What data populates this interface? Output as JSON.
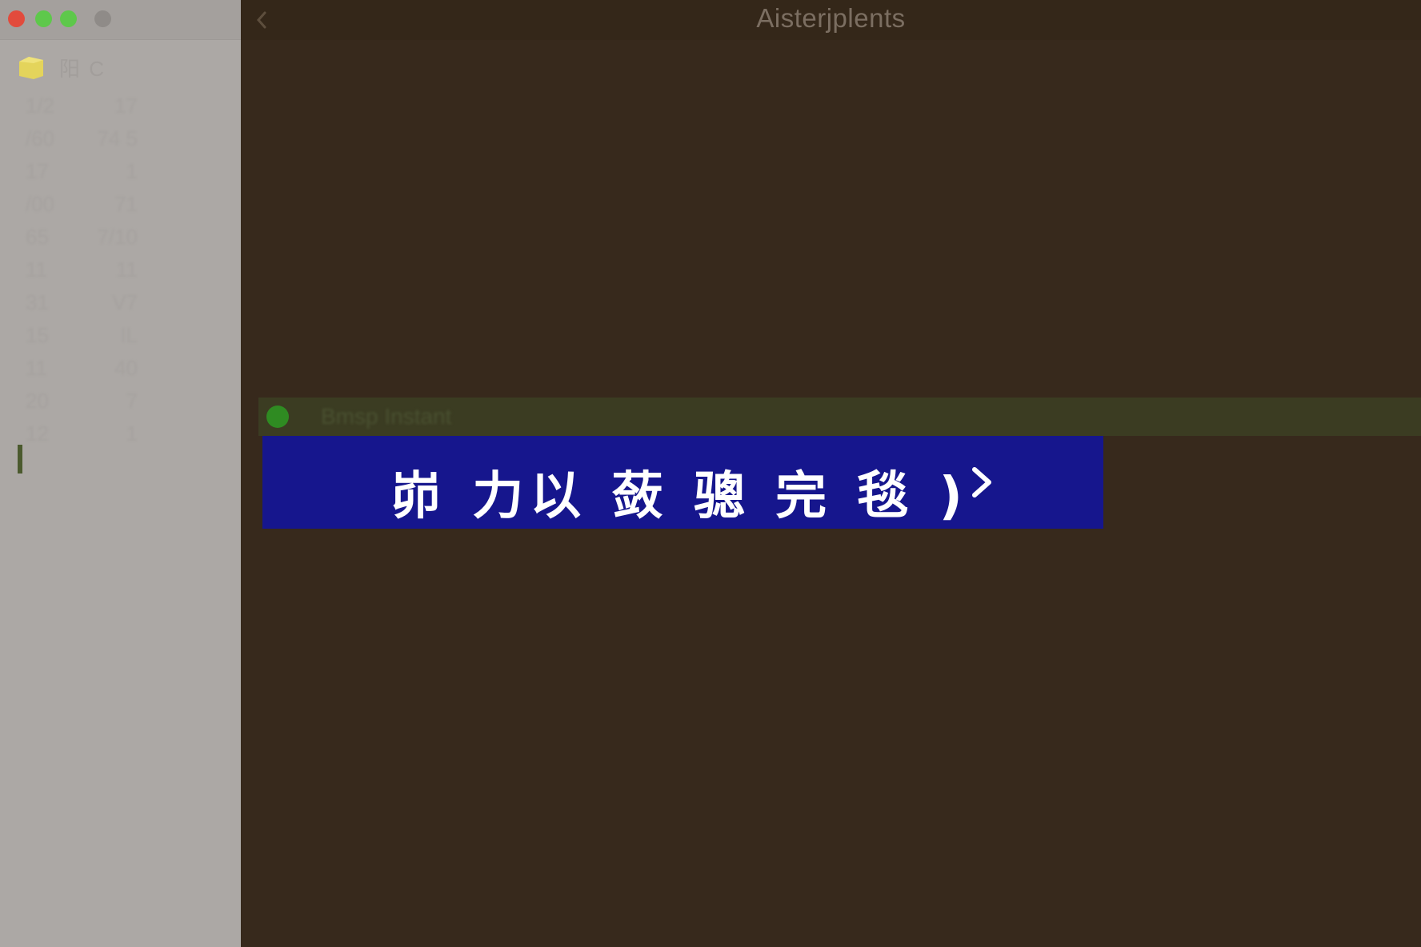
{
  "window": {
    "title": "Aisterjplents",
    "traffic_lights": [
      {
        "name": "close",
        "color": "#e24b3c"
      },
      {
        "name": "minimize",
        "color": "#5ec84b"
      },
      {
        "name": "zoom",
        "color": "#5ec84b"
      },
      {
        "name": "inactive",
        "color": "#8f8b88"
      }
    ]
  },
  "sidebar": {
    "header": {
      "icon": "folder-icon",
      "label": "阳 C",
      "icon_color": "#e4d45b"
    },
    "rows": [
      {
        "left": "1/2",
        "right": "17"
      },
      {
        "left": "/60",
        "right": "74 5"
      },
      {
        "left": "17",
        "right": "1"
      },
      {
        "left": "/00",
        "right": "71"
      },
      {
        "left": "65",
        "right": "7/10"
      },
      {
        "left": "11",
        "right": "11"
      },
      {
        "left": "31",
        "right": "V7"
      },
      {
        "left": "15",
        "right": "IL"
      },
      {
        "left": "11",
        "right": "40"
      },
      {
        "left": "20",
        "right": "7"
      },
      {
        "left": "12",
        "right": "1"
      }
    ]
  },
  "main": {
    "back_icon": "chevron-left-icon",
    "selected_row": {
      "label": "Bmsp Instant",
      "status_color": "#2f8b22",
      "row_color": "#3b3c22"
    },
    "banner": {
      "text": "峁 力以 蔹 骢 完 毯 )",
      "icon": "chevron-right-icon",
      "background": "#16168d"
    }
  }
}
